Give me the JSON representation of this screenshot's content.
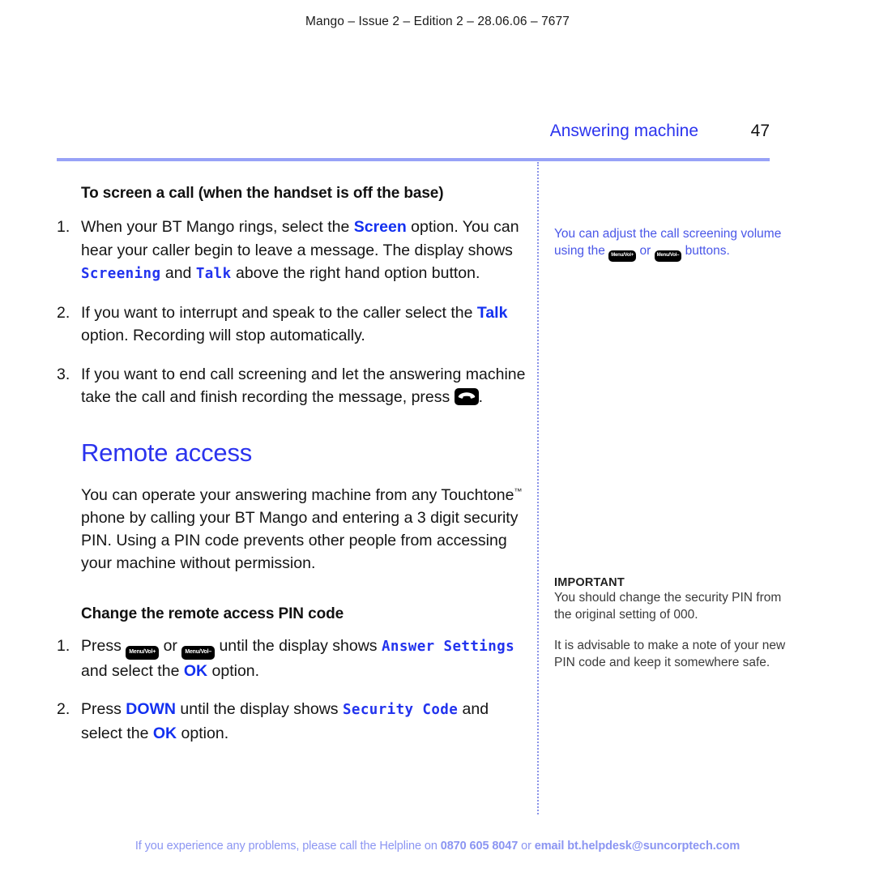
{
  "running_head": "Mango – Issue 2 – Edition 2 – 28.06.06 – 7677",
  "header": {
    "chapter_title": "Answering machine",
    "page_number": "47"
  },
  "main": {
    "subhead_1": "To screen a call (when the handset is off the base)",
    "steps_1": [
      {
        "num": "1.",
        "parts": [
          {
            "type": "text",
            "text": "When your BT Mango rings, select the "
          },
          {
            "type": "kw",
            "text": "Screen"
          },
          {
            "type": "text",
            "text": " option. You can hear your caller begin to leave a message. The display shows "
          },
          {
            "type": "lcd",
            "text": "Screening"
          },
          {
            "type": "text",
            "text": " and "
          },
          {
            "type": "lcd",
            "text": "Talk"
          },
          {
            "type": "text",
            "text": " above the right hand option button."
          }
        ]
      },
      {
        "num": "2.",
        "parts": [
          {
            "type": "text",
            "text": "If you want to interrupt and speak to the caller select the "
          },
          {
            "type": "kw",
            "text": "Talk"
          },
          {
            "type": "text",
            "text": " option. Recording will stop automatically."
          }
        ]
      },
      {
        "num": "3.",
        "parts": [
          {
            "type": "text",
            "text": "If you want to end call screening and let the answering machine take the call and finish recording the message, press "
          },
          {
            "type": "key-hangup",
            "text": "hang-up"
          },
          {
            "type": "text",
            "text": "."
          }
        ]
      }
    ],
    "section_title": "Remote access",
    "paragraph_parts": [
      {
        "type": "text",
        "text": "You can operate your answering machine from any Touchtone"
      },
      {
        "type": "tm",
        "text": "™"
      },
      {
        "type": "text",
        "text": " phone by calling your BT Mango and entering a 3 digit security PIN. Using a PIN code prevents other people from accessing your machine without permission."
      }
    ],
    "subhead_2": "Change the remote access PIN code",
    "steps_2": [
      {
        "num": "1.",
        "parts": [
          {
            "type": "text",
            "text": "Press "
          },
          {
            "type": "key-menu",
            "text": "Menu/Vol+"
          },
          {
            "type": "text",
            "text": " or "
          },
          {
            "type": "key-menu",
            "text": "Menu/Vol–"
          },
          {
            "type": "text",
            "text": " until the display shows "
          },
          {
            "type": "lcd",
            "text": "Answer Settings"
          },
          {
            "type": "text",
            "text": " and select the "
          },
          {
            "type": "kw",
            "text": "OK"
          },
          {
            "type": "text",
            "text": " option."
          }
        ]
      },
      {
        "num": "2.",
        "parts": [
          {
            "type": "text",
            "text": "Press "
          },
          {
            "type": "kw",
            "text": "DOWN"
          },
          {
            "type": "text",
            "text": " until the display shows "
          },
          {
            "type": "lcd",
            "text": "Security Code"
          },
          {
            "type": "text",
            "text": " and select the "
          },
          {
            "type": "kw",
            "text": "OK"
          },
          {
            "type": "text",
            "text": " option."
          }
        ]
      }
    ]
  },
  "side": {
    "note_parts": [
      {
        "type": "text",
        "text": "You can adjust the call screening volume using the "
      },
      {
        "type": "key-menu-small",
        "text": "Menu/Vol+"
      },
      {
        "type": "text",
        "text": " or "
      },
      {
        "type": "key-menu-small",
        "text": "Menu/Vol–"
      },
      {
        "type": "text",
        "text": " buttons."
      }
    ],
    "important_title": "IMPORTANT",
    "important_body_1": "You should change the security PIN from the original setting of 000.",
    "important_body_2": "It is advisable to make a note of your new PIN code and keep it somewhere safe."
  },
  "footer": {
    "parts": [
      {
        "type": "text",
        "text": "If you experience any problems, please call the Helpline on "
      },
      {
        "type": "bold",
        "text": "0870 605 8047"
      },
      {
        "type": "text",
        "text": " or "
      },
      {
        "type": "bold",
        "text": "email bt.helpdesk@suncorptech.com"
      }
    ]
  },
  "colors": {
    "accent_blue": "#2b33ee",
    "keyword_blue": "#1330f0",
    "lcd_blue": "#2233ee",
    "rule_blue": "#98a2f7",
    "side_note_blue": "#4a57e8",
    "footer_blue": "#8b95f2"
  }
}
